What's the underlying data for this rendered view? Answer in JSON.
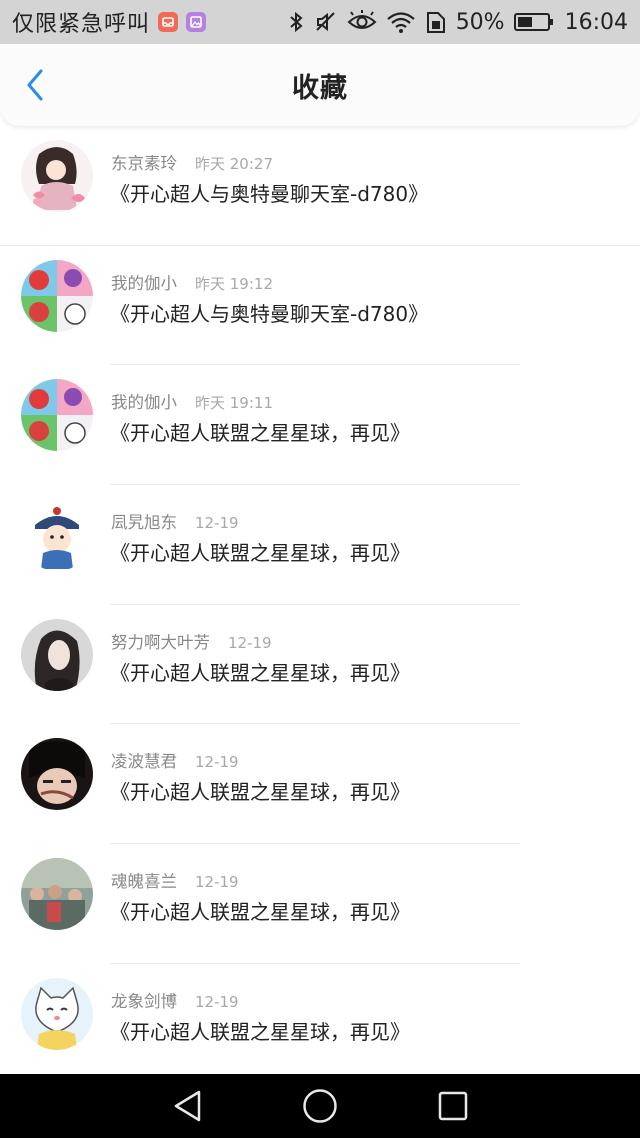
{
  "status_bar": {
    "carrier": "仅限紧急呼叫",
    "battery_percent": "50%",
    "time": "16:04",
    "icons": [
      "mail-notification-icon",
      "image-notification-icon",
      "bluetooth-icon",
      "mute-icon",
      "eye-icon",
      "wifi-icon",
      "sim-icon",
      "battery-icon"
    ]
  },
  "header": {
    "title": "收藏",
    "back_icon": "chevron-left-icon",
    "accent_color": "#2b8ce6"
  },
  "favorites": [
    {
      "user": "东京素玲",
      "time": "昨天 20:27",
      "title": "《开心超人与奥特曼聊天室-d780》",
      "avatar": "anime-girl-avatar"
    },
    {
      "user": "我的伽小",
      "time": "昨天 19:12",
      "title": "《开心超人与奥特曼聊天室-d780》",
      "avatar": "cartoon-grid-avatar"
    },
    {
      "user": "我的伽小",
      "time": "昨天 19:11",
      "title": "《开心超人联盟之星星球，再见》",
      "avatar": "cartoon-grid-avatar"
    },
    {
      "user": "凨旯旭东",
      "time": "12-19",
      "title": "《开心超人联盟之星星球，再见》",
      "avatar": "qing-official-cartoon-avatar"
    },
    {
      "user": "努力啊大叶芳",
      "time": "12-19",
      "title": "《开心超人联盟之星星球，再见》",
      "avatar": "woman-photo-avatar"
    },
    {
      "user": "凌波慧君",
      "time": "12-19",
      "title": "《开心超人联盟之星星球，再见》",
      "avatar": "dark-hair-anime-avatar"
    },
    {
      "user": "魂魄喜兰",
      "time": "12-19",
      "title": "《开心超人联盟之星星球，再见》",
      "avatar": "group-photo-avatar"
    },
    {
      "user": "龙象剑博",
      "time": "12-19",
      "title": "《开心超人联盟之星星球，再见》",
      "avatar": "cartoon-cat-avatar"
    }
  ],
  "nav_bar": {
    "icons": [
      "back-triangle-icon",
      "home-circle-icon",
      "recents-square-icon"
    ]
  }
}
